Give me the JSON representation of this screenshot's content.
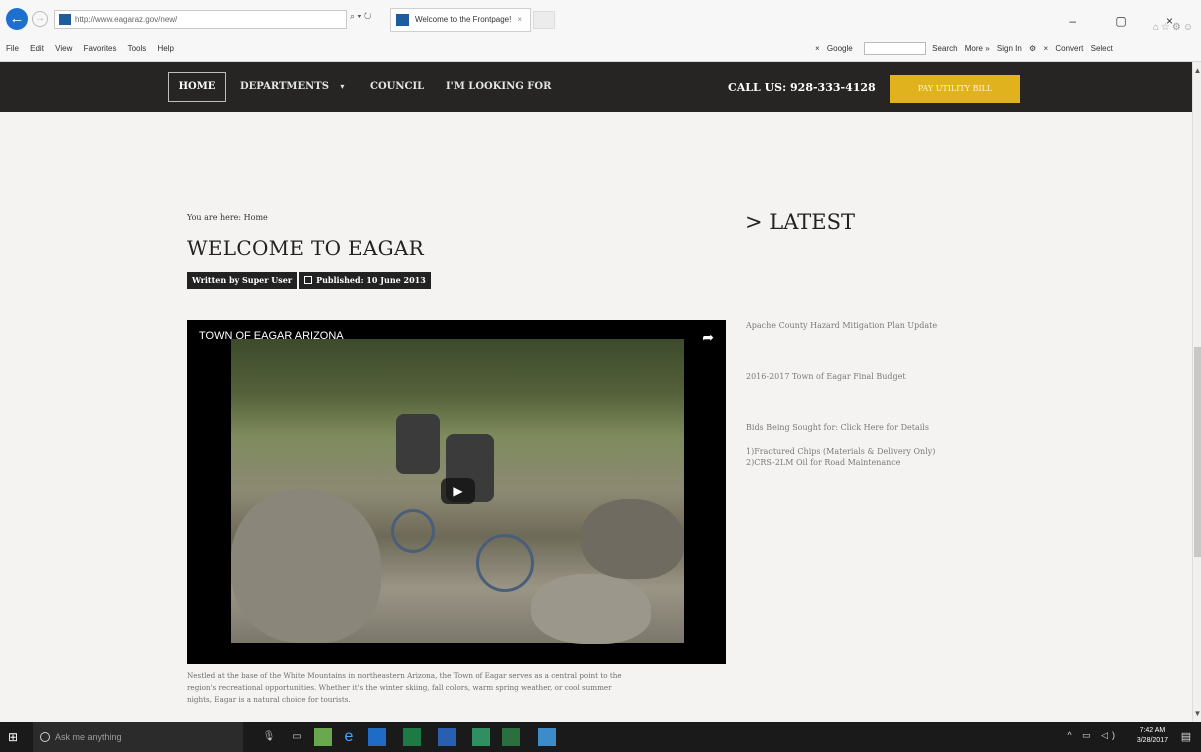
{
  "browser": {
    "address": "http://www.eagaraz.gov/new/",
    "search_ctrl": "⌕ ▾ ↻",
    "tab_title": "Welcome to the Frontpage!",
    "tab_close": "×",
    "window_controls": "– ▢ ×",
    "menu": [
      "File",
      "Edit",
      "View",
      "Favorites",
      "Tools",
      "Help"
    ],
    "toolbar": {
      "google_label": "Google",
      "search_label": "Search",
      "more_label": "More »",
      "signin_label": "Sign In",
      "convert_label": "Convert",
      "select_label": "Select"
    }
  },
  "nav": {
    "home": "HOME",
    "departments": "DEPARTMENTS",
    "council": "COUNCIL",
    "looking_for": "I'M LOOKING FOR",
    "call": "CALL US: 928-333-4128",
    "pay": "PAY UTILITY BILL"
  },
  "article": {
    "breadcrumb": "You are here:  Home",
    "title": "WELCOME TO EAGAR",
    "author": "Written by Super User",
    "published": "Published: 10 June 2013",
    "video_title": "TOWN OF EAGAR ARIZONA",
    "intro_line1": "Nestled at the base of the White Mountains in northeastern Arizona, the Town of Eagar serves as a central point to the",
    "intro_line2": "region's recreational opportunities. Whether it's the winter skiing, fall colors, warm spring weather, or cool summer",
    "intro_line3": "nights, Eagar is a natural choice for tourists."
  },
  "latest": {
    "heading": "> LATEST",
    "items": [
      "Apache County Hazard Mitigation Plan Update",
      "2016-2017 Town of Eagar Final Budget",
      "Bids Being Sought for: Click Here for Details"
    ],
    "bid_line1": "1)Fractured Chips (Materials & Delivery Only)",
    "bid_line2": "2)CRS-2LM Oil for Road Maintenance"
  },
  "taskbar": {
    "ask": "Ask me anything",
    "time": "7:42 AM",
    "date": "3/28/2017"
  },
  "colors": {
    "nav_bg": "#262524",
    "pay_button": "#e0b21e",
    "page_bg": "#f4f3f1"
  }
}
